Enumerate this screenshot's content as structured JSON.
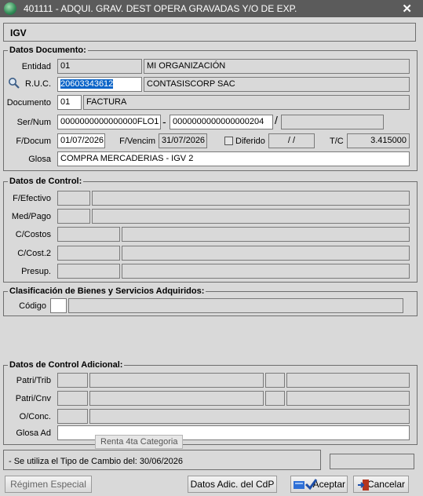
{
  "window": {
    "title": "401111 - ADQUI. GRAV. DEST OPERA GRAVADAS Y/O DE EXP.",
    "close": "✕"
  },
  "header": {
    "title": "IGV"
  },
  "datos_documento": {
    "legend": "Datos Documento:",
    "entidad_label": "Entidad",
    "entidad_code": "01",
    "entidad_name": "MI ORGANIZACIÓN",
    "ruc_label": "R.U.C.",
    "ruc_value": "20603343612",
    "ruc_name": "CONTASISCORP SAC",
    "documento_label": "Documento",
    "documento_code": "01",
    "documento_name": "FACTURA",
    "sernum_label": "Ser/Num",
    "serie": "0000000000000000FLO1",
    "numero": "0000000000000000204",
    "dash": "-",
    "slash": "/",
    "fdocum_label": "F/Docum",
    "fdocum_value": "01/07/2026",
    "fvencim_label": "F/Vencim",
    "fvencim_value": "31/07/2026",
    "diferido_label": "Diferido",
    "diferido_value": "/ /",
    "tc_label": "T/C",
    "tc_value": "3.415000",
    "glosa_label": "Glosa",
    "glosa_value": "COMPRA MERCADERIAS - IGV 2"
  },
  "datos_control": {
    "legend": "Datos de Control:",
    "fefectivo_label": "F/Efectivo",
    "medpago_label": "Med/Pago",
    "ccostos_label": "C/Costos",
    "ccost2_label": "C/Cost.2",
    "presup_label": "Presup."
  },
  "clasificacion": {
    "legend": "Clasificación de Bienes y Servicios Adquiridos:",
    "codigo_label": "Código"
  },
  "control_adicional": {
    "legend": "Datos de Control Adicional:",
    "patritrib_label": "Patri/Trib",
    "patricnv_label": "Patri/Cnv",
    "oconc_label": "O/Conc.",
    "glosaad_label": "Glosa Ad",
    "tooltip": "Renta 4ta Categoria"
  },
  "status": {
    "message": "- Se utiliza el Tipo de Cambio del: 30/06/2026"
  },
  "buttons": {
    "regimen": "Régimen Especial",
    "datos_adic": "Datos Adic. del CdP",
    "aceptar": "Aceptar",
    "cancelar": "Cancelar"
  }
}
